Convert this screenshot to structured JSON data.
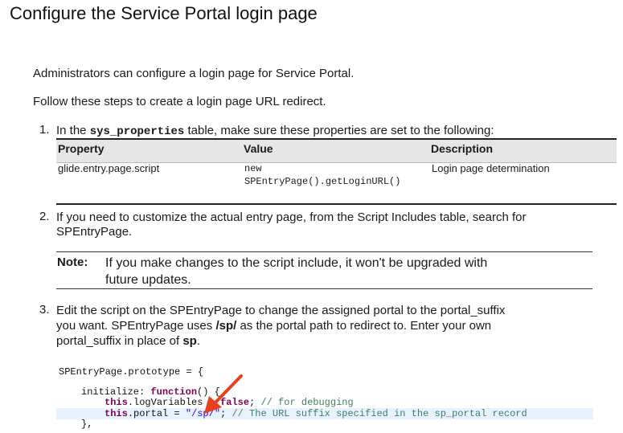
{
  "title": "Configure the Service Portal login page",
  "intro": "Administrators can configure a login page for Service Portal.",
  "steps_intro": "Follow these steps to create a login page URL redirect.",
  "step1": {
    "num": "1.",
    "pre": "In the ",
    "code": "sys_properties",
    "post": " table, make sure these properties are set to the following:"
  },
  "table": {
    "headers": [
      "Property",
      "Value",
      "Description"
    ],
    "row": {
      "property": "glide.entry.page.script",
      "value_line1": "new",
      "value_line2": "SPEntryPage().getLoginURL()",
      "description": "Login page determination"
    }
  },
  "step2": {
    "num": "2.",
    "line1": "If you need to customize the actual entry page, from the Script Includes table, search for",
    "line2": "SPEntryPage."
  },
  "note": {
    "label": "Note:",
    "line1": "If you make changes to the script include, it won't be upgraded with",
    "line2": "future updates."
  },
  "step3": {
    "num": "3.",
    "line1": "Edit the script on the SPEntryPage to change the assigned portal to the portal_suffix",
    "line2_a": "you want. SPEntryPage uses ",
    "line2_b": "/sp/",
    "line2_c": " as the portal path to redirect to. Enter your own",
    "line3_a": "portal_suffix in place of ",
    "line3_b": "sp",
    "line3_c": "."
  },
  "code": {
    "line1": "SPEntryPage.prototype = {",
    "line2_a": "initialize: ",
    "line2_kw": "function",
    "line2_b": "() {",
    "line3_kw": "this",
    "line3_a": ".logVariables = ",
    "line3_kw2": "false",
    "line3_b": ";  ",
    "line3_cmt": "// for debugging",
    "line4_kw": "this",
    "line4_a": ".portal = ",
    "line4_str": "\"/sp/\"",
    "line4_b": ";      ",
    "line4_cmt": "// The URL suffix specified in the sp_portal record",
    "line5": "},"
  },
  "colors": {
    "arrow": "#e8401c",
    "table_header_bg": "#e6e6e6",
    "code_highlight": "#e8f2fe"
  }
}
